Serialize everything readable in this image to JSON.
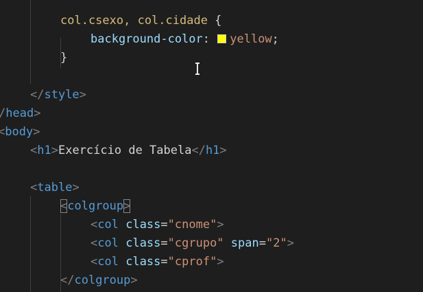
{
  "theme": {
    "background": "#1e1e1e",
    "selector": "#d7ba7d",
    "property": "#9cdcfe",
    "value": "#ce9178",
    "tag": "#569cd6",
    "bracket": "#808080",
    "text": "#d4d4d4",
    "swatch": "#ffff00"
  },
  "code": {
    "css_selector": "col.csexo, col.cidade",
    "open_brace": " {",
    "css_property": "background-color",
    "colon": ": ",
    "css_value": "yellow",
    "semicolon": ";",
    "close_brace": "}",
    "style_tag": "style",
    "head_tag": "head",
    "body_tag": "body",
    "h1_tag": "h1",
    "h1_text": "Exercício de Tabela",
    "table_tag": "table",
    "colgroup_tag": "colgroup",
    "col_tag": "col",
    "class_attr": "class",
    "span_attr": "span",
    "col1_class": "\"cnome\"",
    "col2_class": "\"cgrupo\"",
    "col2_span": "\"2\"",
    "col3_class": "\"cprof\""
  },
  "cursor": "i-beam-cursor-icon"
}
